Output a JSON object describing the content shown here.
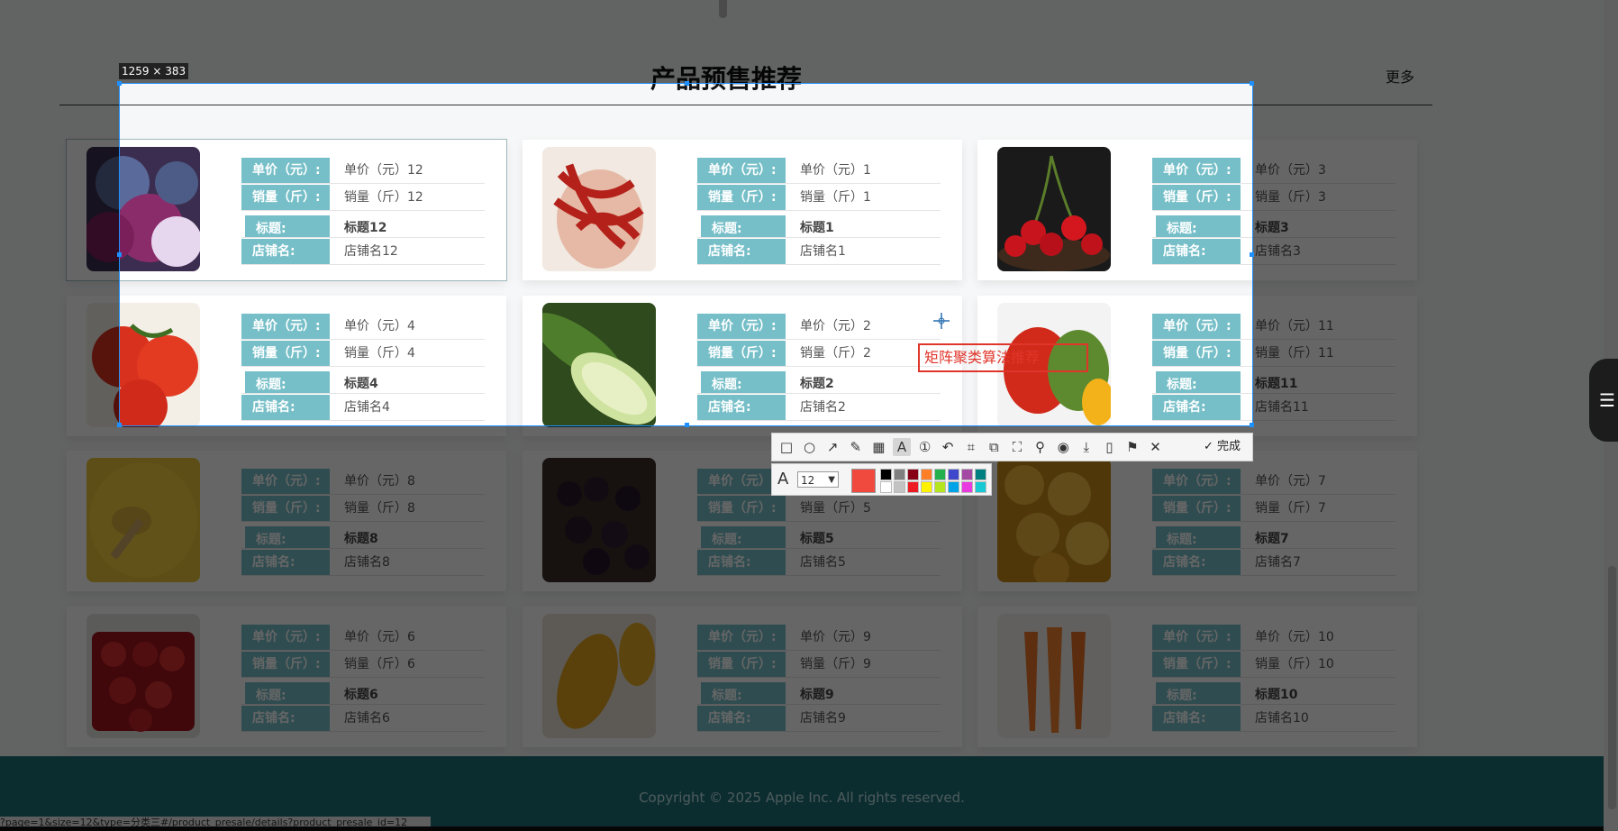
{
  "section": {
    "title": "产品预售推荐",
    "more": "更多"
  },
  "labels": {
    "price": "单价（元）:",
    "sales": "销量（斤）:",
    "title": "标题:",
    "shop": "店铺名:"
  },
  "products": [
    {
      "price": "单价（元）12",
      "sales": "销量（斤）12",
      "title": "标题12",
      "shop": "店铺名12",
      "image": "onion"
    },
    {
      "price": "单价（元）1",
      "sales": "销量（斤）1",
      "title": "标题1",
      "shop": "店铺名1",
      "image": "chili"
    },
    {
      "price": "单价（元）3",
      "sales": "销量（斤）3",
      "title": "标题3",
      "shop": "店铺名3",
      "image": "cherry"
    },
    {
      "price": "单价（元）4",
      "sales": "销量（斤）4",
      "title": "标题4",
      "shop": "店铺名4",
      "image": "tomato"
    },
    {
      "price": "单价（元）2",
      "sales": "销量（斤）2",
      "title": "标题2",
      "shop": "店铺名2",
      "image": "cucumber"
    },
    {
      "price": "单价（元）11",
      "sales": "销量（斤）11",
      "title": "标题11",
      "shop": "店铺名11",
      "image": "pepper"
    },
    {
      "price": "单价（元）8",
      "sales": "销量（斤）8",
      "title": "标题8",
      "shop": "店铺名8",
      "image": "millet"
    },
    {
      "price": "单价（元）5",
      "sales": "销量（斤）5",
      "title": "标题5",
      "shop": "店铺名5",
      "image": "mulberry"
    },
    {
      "price": "单价（元）7",
      "sales": "销量（斤）7",
      "title": "标题7",
      "shop": "店铺名7",
      "image": "lemon"
    },
    {
      "price": "单价（元）6",
      "sales": "销量（斤）6",
      "title": "标题6",
      "shop": "店铺名6",
      "image": "strawberry"
    },
    {
      "price": "单价（元）9",
      "sales": "销量（斤）9",
      "title": "标题9",
      "shop": "店铺名9",
      "image": "mango"
    },
    {
      "price": "单价（元）10",
      "sales": "销量（斤）10",
      "title": "标题10",
      "shop": "店铺名10",
      "image": "carrot"
    }
  ],
  "footer": {
    "copyright": "Copyright © 2025 Apple Inc. All rights reserved."
  },
  "status_url": "?page=1&size=12&type=分类三#/product_presale/details?product_presale_id=12",
  "capture": {
    "size_label": "1259 × 383",
    "annotation_text": "矩阵聚类算法推荐",
    "font_size": "12",
    "done_label": "完成",
    "current_color": "#f0493e",
    "palette": [
      "#000000",
      "#7f7f7f",
      "#880015",
      "#ff7f27",
      "#22b14c",
      "#3f48cc",
      "#a349a4",
      "#008080",
      "#ffffff",
      "#c3c3c3",
      "#ed1c24",
      "#fff200",
      "#b5e61d",
      "#00a2e8",
      "#e83adf",
      "#16c9d3"
    ],
    "tools": [
      "rect-icon",
      "ellipse-icon",
      "arrow-icon",
      "pencil-icon",
      "mosaic-icon",
      "text-icon",
      "serial-icon",
      "undo-icon",
      "crop-icon",
      "copy-icon",
      "scroll-capture-icon",
      "pin-icon",
      "ocr-icon",
      "save-icon",
      "long-screenshot-icon",
      "bookmark-icon",
      "close-icon"
    ]
  },
  "colors": {
    "label_bg": "#76bfc8",
    "footer_bg": "#1f7278",
    "selection": "#1e90ff"
  }
}
